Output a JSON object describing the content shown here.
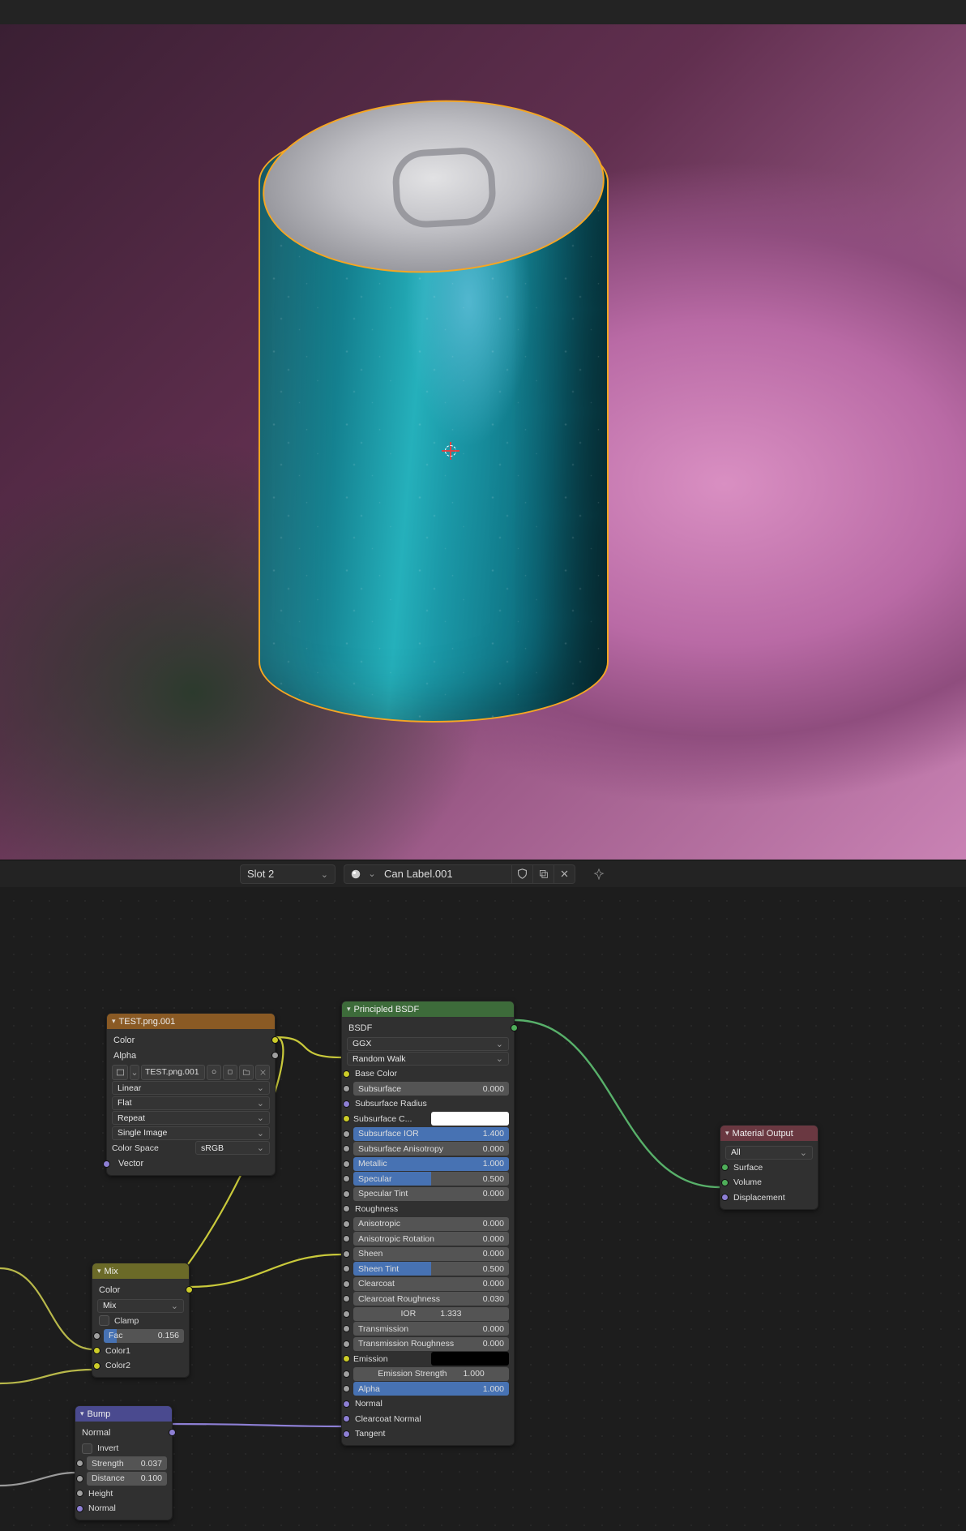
{
  "header": {
    "slot": "Slot 2",
    "material_name": "Can Label.001"
  },
  "nodes": {
    "image_tex": {
      "title": "TEST.png.001",
      "out_color": "Color",
      "out_alpha": "Alpha",
      "file_name": "TEST.png.001",
      "interp": "Linear",
      "projection": "Flat",
      "extension": "Repeat",
      "source": "Single Image",
      "colorspace_label": "Color Space",
      "colorspace_value": "sRGB",
      "in_vector": "Vector"
    },
    "mix": {
      "title": "Mix",
      "out_color": "Color",
      "blend": "Mix",
      "clamp": "Clamp",
      "fac_label": "Fac",
      "fac_value": "0.156",
      "color1": "Color1",
      "color2": "Color2"
    },
    "bump": {
      "title": "Bump",
      "out_normal": "Normal",
      "invert": "Invert",
      "strength_label": "Strength",
      "strength_value": "0.037",
      "distance_label": "Distance",
      "distance_value": "0.100",
      "height": "Height",
      "normal": "Normal"
    },
    "principled": {
      "title": "Principled BSDF",
      "out": "BSDF",
      "distribution": "GGX",
      "sss_method": "Random Walk",
      "base_color": "Base Color",
      "subsurface": {
        "label": "Subsurface",
        "value": "0.000"
      },
      "subsurface_radius": "Subsurface Radius",
      "subsurface_color": "Subsurface C...",
      "subsurface_ior": {
        "label": "Subsurface IOR",
        "value": "1.400"
      },
      "subsurface_aniso": {
        "label": "Subsurface Anisotropy",
        "value": "0.000"
      },
      "metallic": {
        "label": "Metallic",
        "value": "1.000"
      },
      "specular": {
        "label": "Specular",
        "value": "0.500"
      },
      "specular_tint": {
        "label": "Specular Tint",
        "value": "0.000"
      },
      "roughness": "Roughness",
      "anisotropic": {
        "label": "Anisotropic",
        "value": "0.000"
      },
      "aniso_rot": {
        "label": "Anisotropic Rotation",
        "value": "0.000"
      },
      "sheen": {
        "label": "Sheen",
        "value": "0.000"
      },
      "sheen_tint": {
        "label": "Sheen Tint",
        "value": "0.500"
      },
      "clearcoat": {
        "label": "Clearcoat",
        "value": "0.000"
      },
      "clearcoat_rough": {
        "label": "Clearcoat Roughness",
        "value": "0.030"
      },
      "ior": {
        "label": "IOR",
        "value": "1.333"
      },
      "transmission": {
        "label": "Transmission",
        "value": "0.000"
      },
      "transmission_rough": {
        "label": "Transmission Roughness",
        "value": "0.000"
      },
      "emission": "Emission",
      "emission_strength": {
        "label": "Emission Strength",
        "value": "1.000"
      },
      "alpha": {
        "label": "Alpha",
        "value": "1.000"
      },
      "normal": "Normal",
      "clearcoat_normal": "Clearcoat Normal",
      "tangent": "Tangent"
    },
    "material_output": {
      "title": "Material Output",
      "target": "All",
      "surface": "Surface",
      "volume": "Volume",
      "displacement": "Displacement"
    }
  }
}
